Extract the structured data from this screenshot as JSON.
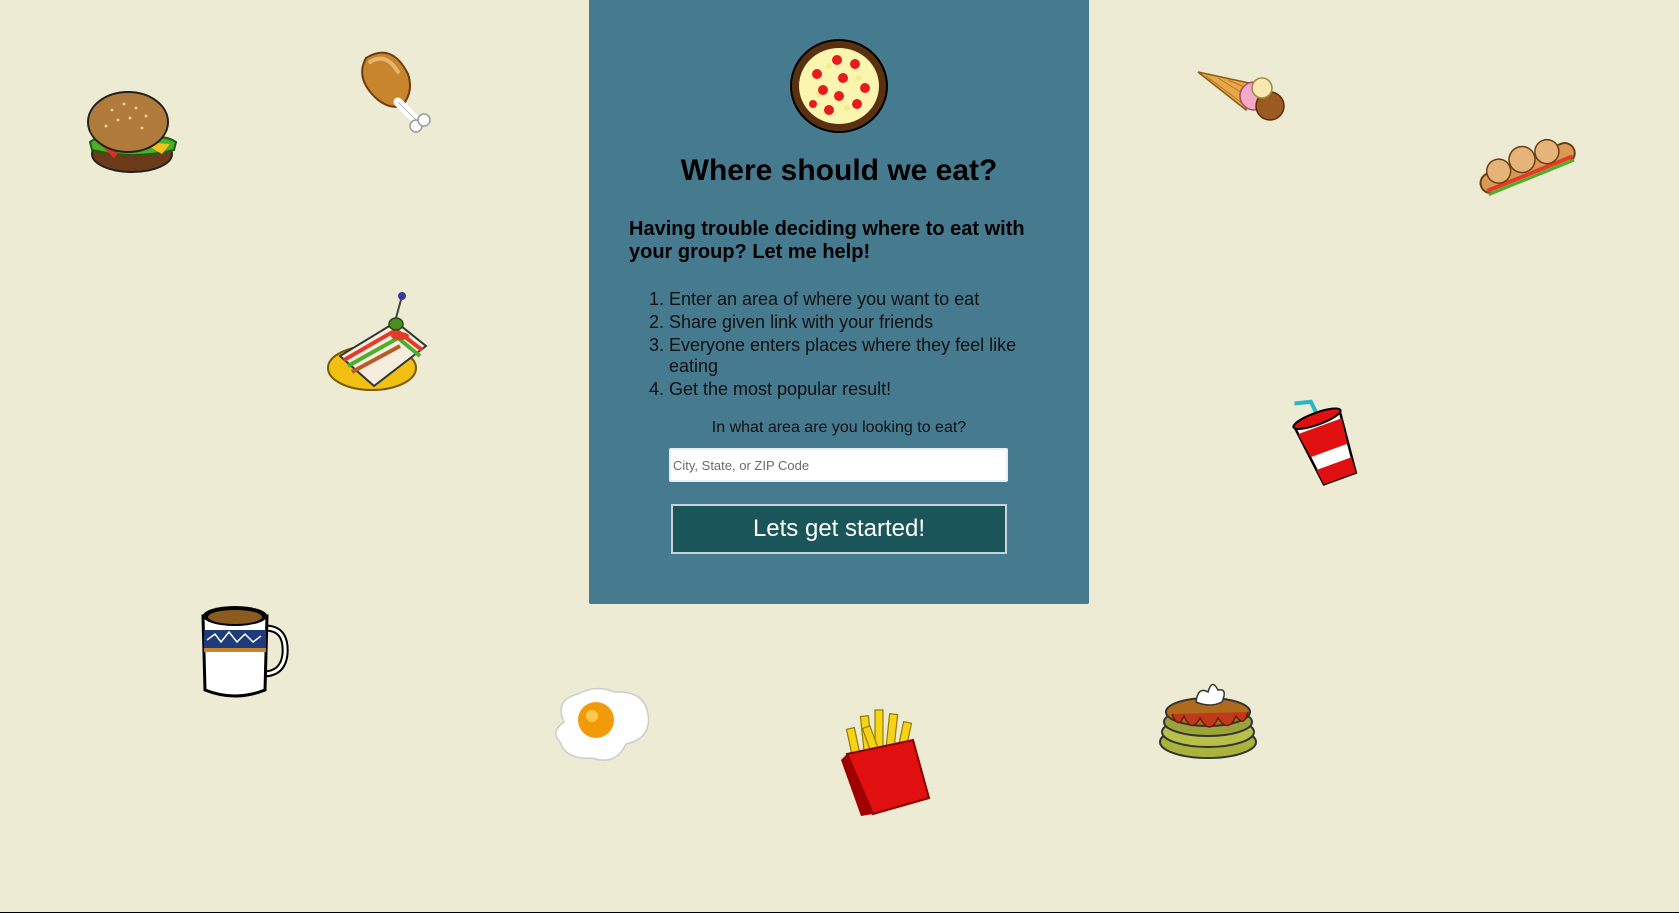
{
  "page": {
    "background_color": "#edebd4"
  },
  "card": {
    "background_color": "#467a8f",
    "logo_icon": "pizza-icon",
    "title": "Where should we eat?",
    "subtitle": "Having trouble deciding where to eat with your group? Let me help!",
    "steps": [
      "Enter an area of where you want to eat",
      "Share given link with your friends",
      "Everyone enters places where they feel like eating",
      "Get the most popular result!"
    ],
    "area_prompt": "In what area are you looking to eat?",
    "area_input": {
      "value": "",
      "placeholder": "City, State, or ZIP Code"
    },
    "start_button_label": "Lets get started!",
    "button_color": "#1a5659"
  },
  "decorations": [
    "hamburger-icon",
    "chicken-drumstick-icon",
    "club-sandwich-icon",
    "coffee-mug-icon",
    "fried-egg-icon",
    "french-fries-icon",
    "pancakes-icon",
    "soda-cup-icon",
    "ice-cream-cone-icon",
    "sub-sandwich-icon"
  ]
}
